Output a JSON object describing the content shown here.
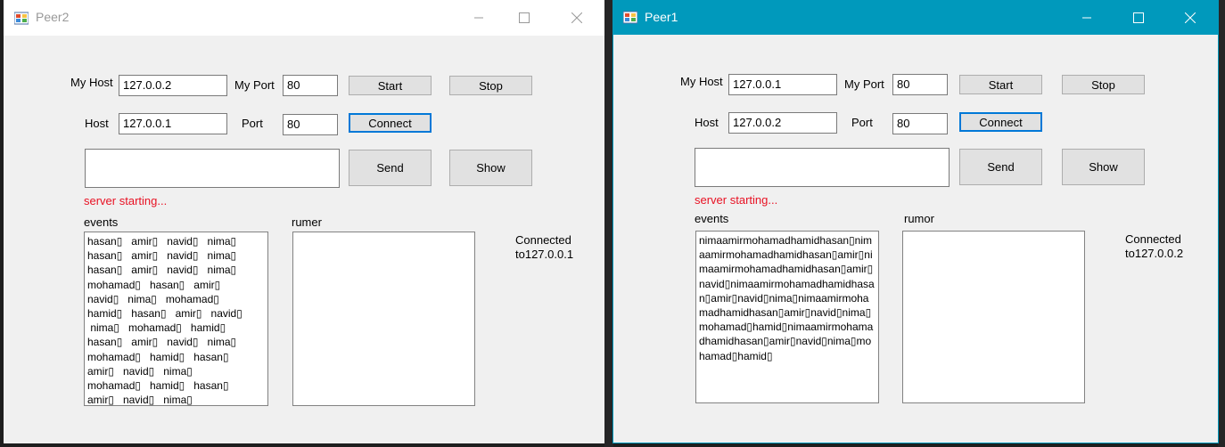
{
  "peer2": {
    "title": "Peer2",
    "minimize_icon": "minimize-icon",
    "maximize_icon": "maximize-icon",
    "close_icon": "close-icon",
    "my_host_label": "My Host",
    "my_host_value": "127.0.0.2",
    "my_port_label": "My Port",
    "my_port_value": "80",
    "start_label": "Start",
    "stop_label": "Stop",
    "host_label": "Host",
    "host_value": "127.0.0.1",
    "port_label": "Port",
    "port_value": "80",
    "connect_label": "Connect",
    "message_value": "",
    "send_label": "Send",
    "show_label": "Show",
    "status": "server starting...",
    "events_label": "events",
    "rumor_label": "rumer",
    "connected_line1": "Connected",
    "connected_line2": "to127.0.0.1",
    "events": [
      "hasan▯   amir▯   navid▯   nima▯",
      "hasan▯   amir▯   navid▯   nima▯",
      "hasan▯   amir▯   navid▯   nima▯",
      "mohamad▯   hasan▯   amir▯",
      "navid▯   nima▯   mohamad▯",
      "hamid▯   hasan▯   amir▯   navid▯",
      " nima▯   mohamad▯   hamid▯",
      "hasan▯   amir▯   navid▯   nima▯",
      "mohamad▯   hamid▯   hasan▯",
      "amir▯   navid▯   nima▯",
      "mohamad▯   hamid▯   hasan▯",
      "amir▯   navid▯   nima▯"
    ]
  },
  "peer1": {
    "title": "Peer1",
    "minimize_icon": "minimize-icon",
    "maximize_icon": "maximize-icon",
    "close_icon": "close-icon",
    "accent": "#0099bc",
    "my_host_label": "My Host",
    "my_host_value": "127.0.0.1",
    "my_port_label": "My Port",
    "my_port_value": "80",
    "start_label": "Start",
    "stop_label": "Stop",
    "host_label": "Host",
    "host_value": "127.0.0.2",
    "port_label": "Port",
    "port_value": "80",
    "connect_label": "Connect",
    "message_value": "",
    "send_label": "Send",
    "show_label": "Show",
    "status": "server starting...",
    "events_label": "events",
    "rumor_label": "rumor",
    "connected_line1": "Connected",
    "connected_line2": "to127.0.0.2",
    "events_text": "nimaamirmohamadhamidhasan▯nimaamirmohamadhamidhasan▯amir▯nimaamirmohamadhamidhasan▯amir▯navid▯nimaamirmohamadhamidhasan▯amir▯navid▯nima▯nimaamirmohamadhamidhasan▯amir▯navid▯nima▯mohamad▯hamid▯nimaamirmohamadhamidhasan▯amir▯navid▯nima▯mohamad▯hamid▯"
  }
}
